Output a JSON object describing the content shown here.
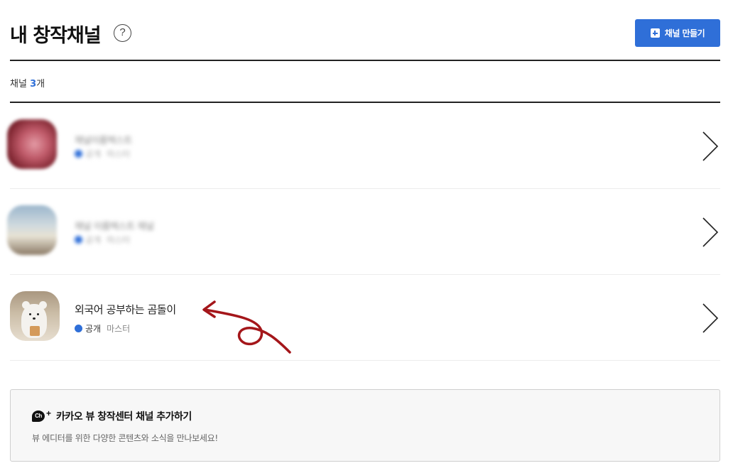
{
  "header": {
    "title": "내 창작채널",
    "help_icon": "question-circle-icon",
    "create_button_label": "채널 만들기",
    "create_button_icon": "plus-square-icon",
    "accent_color": "#2f6fd8"
  },
  "channel_count": {
    "prefix": "채널 ",
    "count": "3",
    "suffix": "개"
  },
  "channels": [
    {
      "name": "채널이름텍스트",
      "visibility": "공개",
      "role": "마스터",
      "blurred": true,
      "thumbnail": "blurred-red-avatar"
    },
    {
      "name": "채널 이름텍스트 채널",
      "visibility": "공개",
      "role": "마스터",
      "blurred": true,
      "thumbnail": "blurred-landscape-avatar"
    },
    {
      "name": "외국어 공부하는 곰돌이",
      "visibility": "공개",
      "role": "마스터",
      "blurred": false,
      "thumbnail": "polar-bear-avatar"
    }
  ],
  "row_chevron_icon": "chevron-right-icon",
  "promo": {
    "icon": "kakao-channel-plus-icon",
    "icon_text": "Ch",
    "icon_plus": "+",
    "title": "카카오 뷰 창작센터 채널 추가하기",
    "description": "뷰 에디터를 위한 다양한 콘텐츠와 소식을 만나보세요!"
  }
}
